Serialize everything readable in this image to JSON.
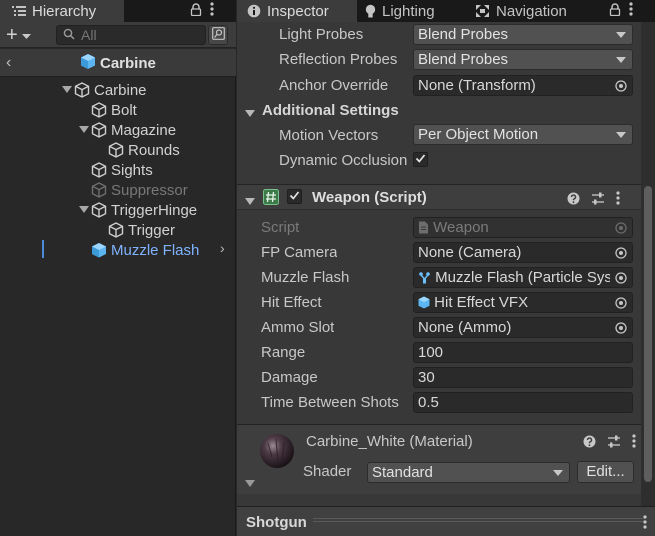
{
  "hierarchy": {
    "tab_label": "Hierarchy",
    "add_label": "+",
    "search_placeholder": "All",
    "title": "Carbine",
    "items": [
      {
        "label": "Carbine",
        "depth": 0,
        "fold": "open",
        "state": "normal"
      },
      {
        "label": "Bolt",
        "depth": 1,
        "fold": "none",
        "state": "normal"
      },
      {
        "label": "Magazine",
        "depth": 1,
        "fold": "open",
        "state": "normal"
      },
      {
        "label": "Rounds",
        "depth": 2,
        "fold": "none",
        "state": "normal"
      },
      {
        "label": "Sights",
        "depth": 1,
        "fold": "none",
        "state": "normal"
      },
      {
        "label": "Suppressor",
        "depth": 1,
        "fold": "none",
        "state": "disabled"
      },
      {
        "label": "TriggerHinge",
        "depth": 1,
        "fold": "open",
        "state": "normal"
      },
      {
        "label": "Trigger",
        "depth": 2,
        "fold": "none",
        "state": "normal"
      },
      {
        "label": "Muzzle Flash",
        "depth": 1,
        "fold": "none",
        "state": "selected"
      }
    ]
  },
  "inspector": {
    "tabs": {
      "inspector": "Inspector",
      "lighting": "Lighting",
      "navigation": "Navigation"
    },
    "renderer": {
      "light_probes_label": "Light Probes",
      "light_probes_value": "Blend Probes",
      "reflection_probes_label": "Reflection Probes",
      "reflection_probes_value": "Blend Probes",
      "anchor_override_label": "Anchor Override",
      "anchor_override_value": "None (Transform)",
      "additional_settings_label": "Additional Settings",
      "motion_vectors_label": "Motion Vectors",
      "motion_vectors_value": "Per Object Motion",
      "dynamic_occlusion_label": "Dynamic Occlusion",
      "dynamic_occlusion_checked": true
    },
    "weapon": {
      "title": "Weapon (Script)",
      "enabled": true,
      "script_label": "Script",
      "script_value": "Weapon",
      "fp_camera_label": "FP Camera",
      "fp_camera_value": "None (Camera)",
      "muzzle_flash_label": "Muzzle Flash",
      "muzzle_flash_value": "Muzzle Flash (Particle System)",
      "hit_effect_label": "Hit Effect",
      "hit_effect_value": "Hit Effect VFX",
      "ammo_slot_label": "Ammo Slot",
      "ammo_slot_value": "None (Ammo)",
      "range_label": "Range",
      "range_value": "100",
      "damage_label": "Damage",
      "damage_value": "30",
      "time_between_label": "Time Between Shots",
      "time_between_value": "0.5"
    },
    "material": {
      "name": "Carbine_White (Material)",
      "shader_label": "Shader",
      "shader_value": "Standard",
      "edit_label": "Edit..."
    },
    "bottom": {
      "label": "Shotgun"
    }
  },
  "colors": {
    "selected_text": "#7fb3ff",
    "accent_blue": "#4a8ad8",
    "panel_bg": "#383838",
    "hierarchy_bg": "#282828"
  }
}
